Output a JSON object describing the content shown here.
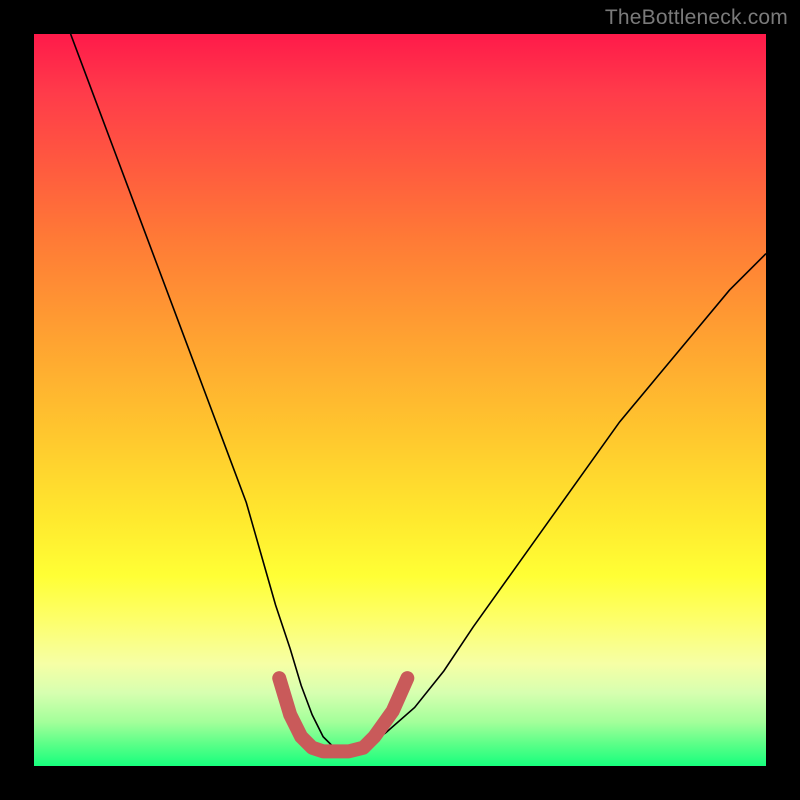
{
  "watermark": {
    "text": "TheBottleneck.com"
  },
  "chart_data": {
    "type": "line",
    "title": "",
    "xlabel": "",
    "ylabel": "",
    "xlim": [
      0,
      100
    ],
    "ylim": [
      0,
      100
    ],
    "grid": false,
    "series": [
      {
        "name": "bottleneck-curve",
        "stroke": "#000000",
        "stroke_width": 1.6,
        "x": [
          5,
          8,
          11,
          14,
          17,
          20,
          23,
          26,
          29,
          31,
          33,
          35,
          36.5,
          38,
          39.5,
          41,
          43,
          45,
          48,
          52,
          56,
          60,
          65,
          70,
          75,
          80,
          85,
          90,
          95,
          100
        ],
        "y": [
          100,
          92,
          84,
          76,
          68,
          60,
          52,
          44,
          36,
          29,
          22,
          16,
          11,
          7,
          4,
          2.5,
          2,
          2.5,
          4.5,
          8,
          13,
          19,
          26,
          33,
          40,
          47,
          53,
          59,
          65,
          70
        ]
      },
      {
        "name": "trough-marker",
        "stroke": "#c95a5a",
        "stroke_width": 14,
        "linecap": "round",
        "x": [
          33.5,
          35,
          36.5,
          38,
          39.5,
          41,
          43,
          45,
          46.5,
          49,
          51
        ],
        "y": [
          12,
          7,
          4,
          2.5,
          2,
          2,
          2,
          2.5,
          4,
          7.5,
          12
        ]
      }
    ],
    "background": {
      "type": "vertical-gradient",
      "stops": [
        {
          "pct": 0,
          "color": "#ff1a4a"
        },
        {
          "pct": 18,
          "color": "#ff5a3f"
        },
        {
          "pct": 42,
          "color": "#ffa331"
        },
        {
          "pct": 66,
          "color": "#ffe82e"
        },
        {
          "pct": 86,
          "color": "#f6ffa5"
        },
        {
          "pct": 100,
          "color": "#17ff7d"
        }
      ]
    }
  }
}
